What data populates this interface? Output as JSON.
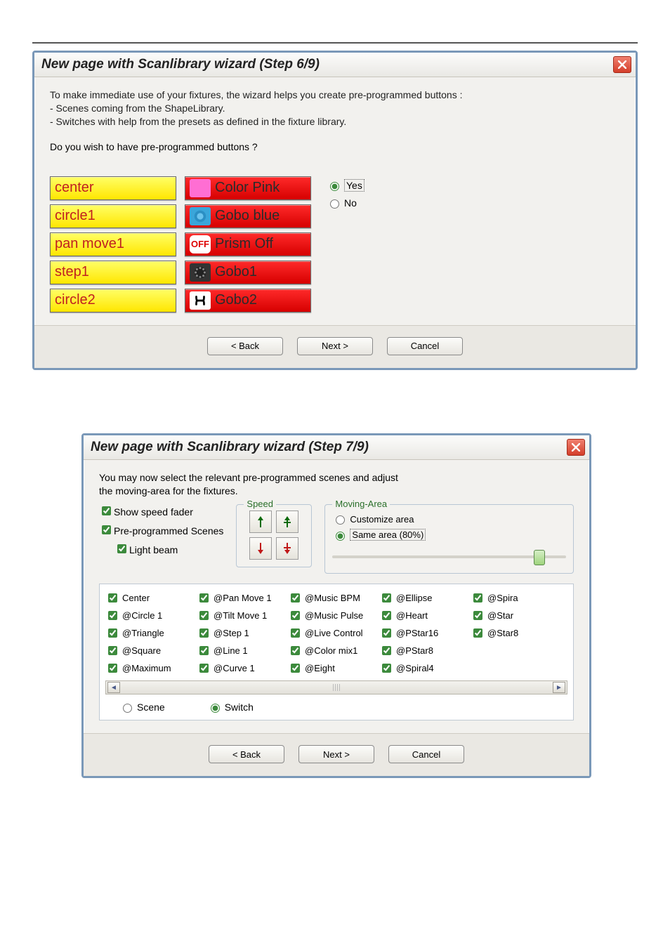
{
  "dialog1": {
    "title": "New page with Scanlibrary wizard (Step 6/9)",
    "intro_l1": "To make immediate use of your fixtures, the wizard helps you create pre-programmed buttons :",
    "intro_l2": "- Scenes coming from the ShapeLibrary.",
    "intro_l3": "- Switches with help from the presets as defined in the fixture library.",
    "question": "Do you wish to have pre-programmed buttons ?",
    "yellow_buttons": [
      "center",
      "circle1",
      "pan move1",
      "step1",
      "circle2"
    ],
    "red_buttons": [
      {
        "icon": "pink",
        "label": "Color Pink"
      },
      {
        "icon": "blue",
        "label": "Gobo blue"
      },
      {
        "icon": "off",
        "label": "Prism Off",
        "offtext": "OFF"
      },
      {
        "icon": "gobo1",
        "label": "Gobo1"
      },
      {
        "icon": "gobo2",
        "label": "Gobo2"
      }
    ],
    "radio_yes": "Yes",
    "radio_no": "No",
    "back": "< Back",
    "next": "Next >",
    "cancel": "Cancel"
  },
  "dialog2": {
    "title": "New page with Scanlibrary wizard (Step 7/9)",
    "intro_l1": "You may now select the relevant pre-programmed scenes and adjust",
    "intro_l2": "the moving-area for the fixtures.",
    "chk_speed": "Show speed fader",
    "chk_preprog": "Pre-programmed Scenes",
    "chk_light": "Light beam",
    "speed_legend": "Speed",
    "moving_legend": "Moving-Area",
    "moving_custom": "Customize area",
    "moving_same": "Same area (80%)",
    "grid": {
      "c1": [
        "Center",
        "@Circle 1",
        "@Triangle",
        "@Square",
        "@Maximum"
      ],
      "c2": [
        "@Pan Move 1",
        "@Tilt Move 1",
        "@Step 1",
        "@Line 1",
        "@Curve 1"
      ],
      "c3": [
        "@Music BPM",
        "@Music Pulse",
        "@Live Control",
        "@Color mix1",
        "@Eight"
      ],
      "c4": [
        "@Ellipse",
        "@Heart",
        "@PStar16",
        "@PStar8",
        "@Spiral4"
      ],
      "c5": [
        "@Spira",
        "@Star",
        "@Star8"
      ]
    },
    "scene": "Scene",
    "switch": "Switch",
    "back": "< Back",
    "next": "Next >",
    "cancel": "Cancel"
  }
}
